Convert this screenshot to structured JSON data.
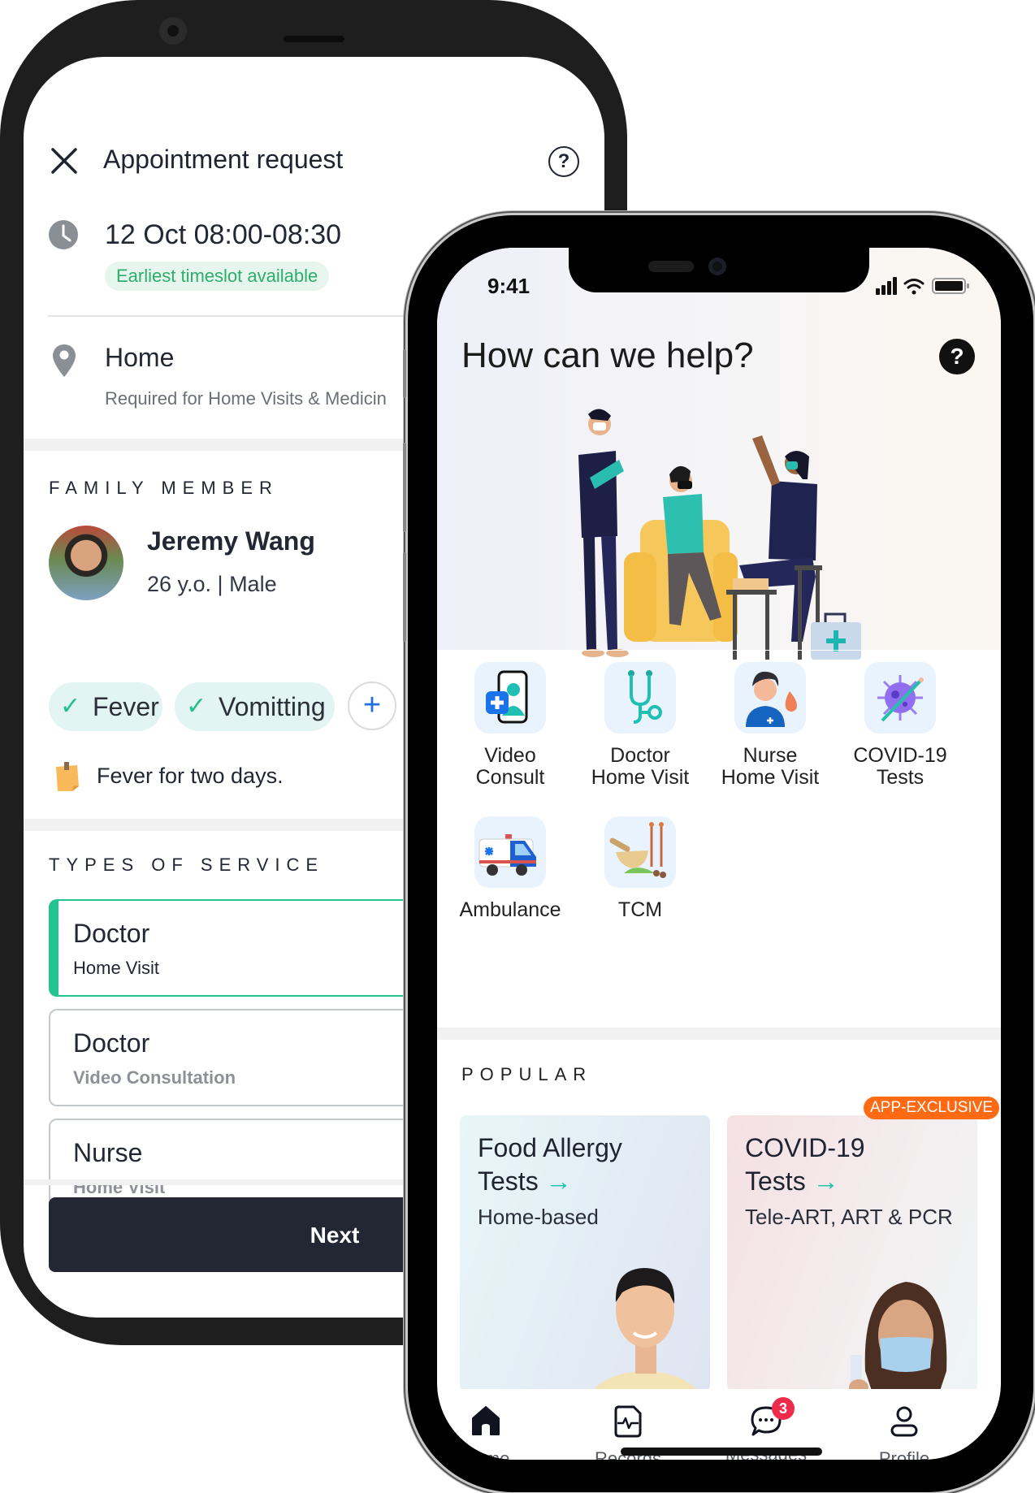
{
  "android": {
    "header": {
      "title": "Appointment request"
    },
    "timeslot": {
      "value": "12 Oct 08:00-08:30",
      "badge": "Earliest timeslot available"
    },
    "location": {
      "title": "Home",
      "subtitle": "Required for Home Visits & Medicin"
    },
    "family_member": {
      "section_label": "FAMILY MEMBER",
      "name": "Jeremy Wang",
      "info": "26 y.o. | Male",
      "symptoms": [
        {
          "label": "Fever",
          "selected": true
        },
        {
          "label": "Vomitting",
          "selected": true
        }
      ],
      "add_symptom_icon": "plus-icon",
      "note": "Fever for two days."
    },
    "types_of_service": {
      "section_label": "TYPES OF SERVICE",
      "options": [
        {
          "title": "Doctor",
          "subtitle": "Home Visit",
          "selected": true
        },
        {
          "title": "Doctor",
          "subtitle": "Video Consultation",
          "selected": false
        },
        {
          "title": "Nurse",
          "subtitle": "Home Visit",
          "selected": false
        }
      ]
    },
    "next_label": "Next"
  },
  "iphone": {
    "status_bar": {
      "time": "9:41"
    },
    "title": "How can we help?",
    "services": [
      {
        "label_line1": "Video",
        "label_line2": "Consult",
        "icon": "video-consult-icon"
      },
      {
        "label_line1": "Doctor",
        "label_line2": "Home Visit",
        "icon": "stethoscope-icon"
      },
      {
        "label_line1": "Nurse",
        "label_line2": "Home Visit",
        "icon": "nurse-icon"
      },
      {
        "label_line1": "COVID-19",
        "label_line2": "Tests",
        "icon": "virus-icon"
      },
      {
        "label_line1": "Ambulance",
        "label_line2": "",
        "icon": "ambulance-icon"
      },
      {
        "label_line1": "TCM",
        "label_line2": "",
        "icon": "tcm-icon"
      }
    ],
    "popular": {
      "section_label": "POPULAR",
      "cards": [
        {
          "title_line1": "Food Allergy",
          "title_line2": "Tests",
          "arrow": "→",
          "subtitle": "Home-based",
          "badge": ""
        },
        {
          "title_line1": "COVID-19",
          "title_line2": "Tests",
          "arrow": "→",
          "subtitle": "Tele-ART, ART & PCR",
          "badge": "APP-EXCLUSIVE"
        }
      ]
    },
    "tabbar": [
      {
        "label": "Home",
        "icon": "home-icon",
        "active": true
      },
      {
        "label": "Records",
        "icon": "records-icon",
        "active": false
      },
      {
        "label": "Messages",
        "icon": "chat-icon",
        "active": false,
        "badge": "3"
      },
      {
        "label": "Profile",
        "icon": "profile-icon",
        "active": false
      }
    ]
  },
  "colors": {
    "accent_green": "#22c38e",
    "badge_orange": "#ff6a13",
    "badge_red": "#ee2b4b",
    "dark_button": "#232733",
    "link_blue": "#1f6fe0"
  }
}
